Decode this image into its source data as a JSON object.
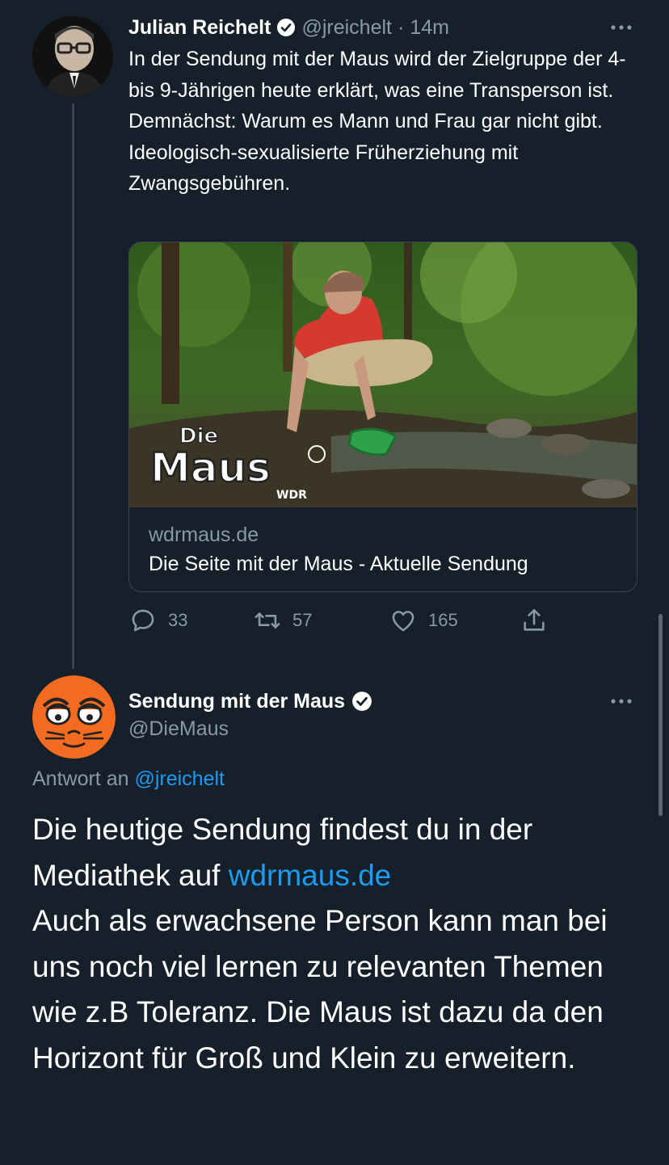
{
  "tweet": {
    "author_name": "Julian Reichelt",
    "author_handle": "@jreichelt",
    "separator": "·",
    "time": "14m",
    "text": "In der Sendung mit der Maus wird der Zielgruppe der 4- bis 9-Jährigen heute erklärt, was eine Transperson ist. Demnächst: Warum es Mann und Frau gar nicht gibt. Ideologisch-sexualisierte Früherziehung mit Zwangsgebühren.",
    "card": {
      "logo_top": "Die",
      "logo_main": "Maus",
      "logo_sub": "WDR",
      "domain": "wdrmaus.de",
      "title": "Die Seite mit der Maus - Aktuelle Sendung"
    },
    "actions": {
      "replies": "33",
      "retweets": "57",
      "likes": "165"
    }
  },
  "reply": {
    "author_name": "Sendung mit der Maus",
    "author_handle": "@DieMaus",
    "replying_prefix": "Antwort an",
    "replying_to": "@jreichelt",
    "text_part1": "Die heutige Sendung findest du in der Mediathek auf",
    "link": "wdrmaus.de",
    "text_part2": "Auch als erwachsene Person kann man bei uns noch viel lernen zu relevanten Themen wie z.B Toleranz. Die Maus ist dazu da den Horizont für Groß und Klein zu erweitern."
  },
  "colors": {
    "background": "#15202b",
    "link": "#1d9bf0",
    "muted": "#8b98a5",
    "verified": "#ffffff"
  },
  "icons": [
    "more-icon",
    "verified-icon",
    "reply-icon",
    "retweet-icon",
    "like-icon",
    "share-icon"
  ]
}
